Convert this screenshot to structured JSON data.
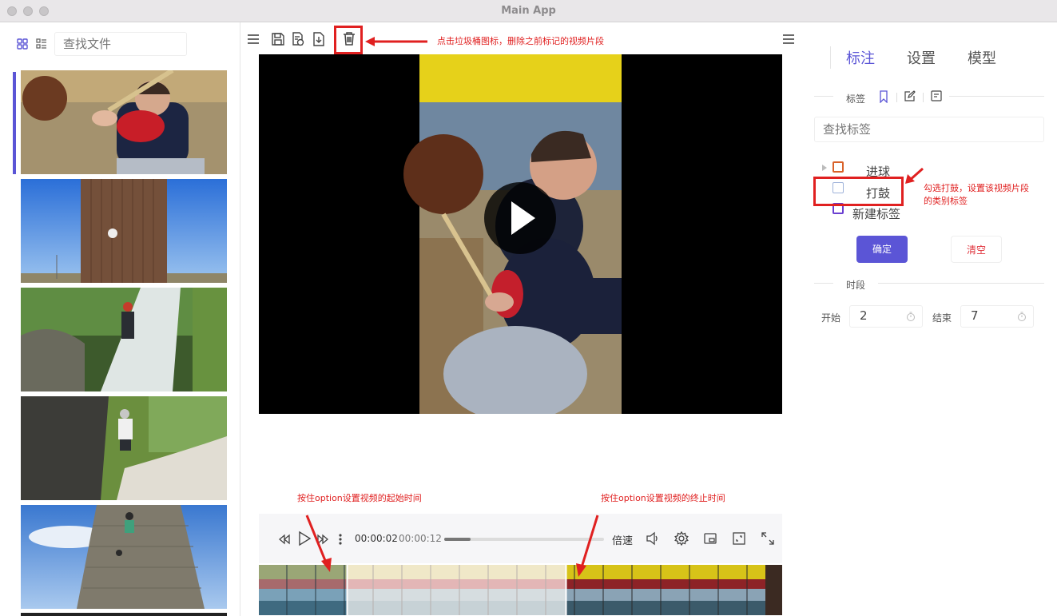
{
  "window": {
    "title": "Main App"
  },
  "sidebar": {
    "search_placeholder": "查找文件",
    "view_icons": [
      "grid-view-icon",
      "list-view-icon"
    ]
  },
  "toolbar": {
    "icons": [
      "menu-icon",
      "save-icon",
      "save-as-icon",
      "export-icon",
      "trash-icon",
      "more-menu-icon"
    ]
  },
  "player": {
    "current_time": "00:00:02",
    "total_time": "00:00:12",
    "speed_label": "倍速",
    "progress": 0.167
  },
  "right_panel": {
    "tabs": [
      "标注",
      "设置",
      "模型"
    ],
    "active_tab": "标注",
    "labels_section": "标签",
    "search_tags_placeholder": "查找标签",
    "tags": [
      {
        "label": "进球",
        "color": "#d9622a"
      },
      {
        "label": "打鼓",
        "color": "#9fb3da"
      },
      {
        "label": "新建标签",
        "color": "#6a3fd1"
      }
    ],
    "confirm_label": "确定",
    "clear_label": "清空",
    "time_section": "时段",
    "start_label": "开始",
    "start_value": "2",
    "end_label": "结束",
    "end_value": "7"
  },
  "annotations": {
    "delete_note": "点击垃圾桶图标，删除之前标记的视频片段",
    "tag_note_line1": "勾选打鼓，设置该视频片段",
    "tag_note_line2": "的类别标签",
    "start_note": "按住option设置视频的起始时间",
    "end_note": "按住option设置视频的终止时间"
  },
  "colors": {
    "accent": "#5b55d6",
    "danger": "#e02020"
  }
}
